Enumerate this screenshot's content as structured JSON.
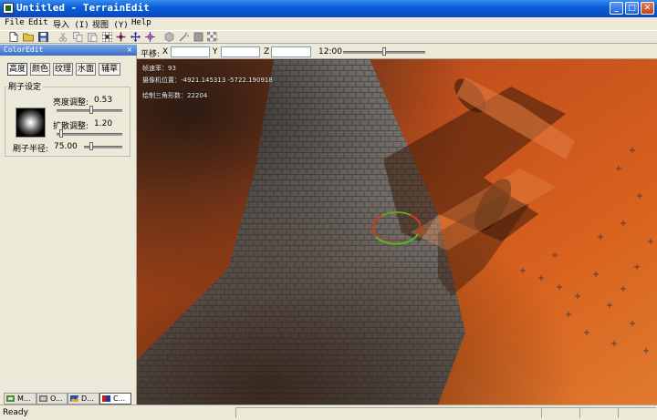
{
  "window": {
    "title": "Untitled - TerrainEdit",
    "minimize": "_",
    "maximize": "□",
    "close": "✕"
  },
  "menu": [
    "File",
    "Edit",
    "导入 (I)",
    "视图 (Y)",
    "Help"
  ],
  "toolbar": {
    "icons": [
      "new-file-icon",
      "open-folder-icon",
      "save-icon",
      "cut-icon",
      "copy-icon",
      "paste-icon",
      "grid-icon",
      "add-node-icon",
      "move-icon",
      "crosshair-icon",
      "cube-icon",
      "wand-icon",
      "block-icon",
      "checker-icon"
    ]
  },
  "panel": {
    "title": "ColorEdit",
    "close": "×",
    "tabs": [
      "高度",
      "颜色",
      "纹理",
      "水面",
      "辅草"
    ],
    "group_label": "刷子设定",
    "brightness_label": "亮度调整:",
    "brightness_value": "0.53",
    "brightness_level": 0.53,
    "spread_label": "扩散调整:",
    "spread_value": "1.20",
    "spread_level": 0.05,
    "radius_label": "刷子半径:",
    "radius_value": "75.00",
    "radius_level": 0.15
  },
  "bottom_tabs": [
    {
      "label": "M...",
      "icon": "layer-icon"
    },
    {
      "label": "O...",
      "icon": "object-icon"
    },
    {
      "label": "D...",
      "icon": "texture-icon"
    },
    {
      "label": "C...",
      "icon": "color-icon"
    }
  ],
  "controls": {
    "move_label": "平移:",
    "x_label": "X",
    "y_label": "Y",
    "z_label": "Z",
    "x_value": "",
    "y_value": "",
    "z_value": "",
    "time": "12:00",
    "time_level": 0.5
  },
  "viewport": {
    "fps": "帧速率：93",
    "camera": "摄像机位置：-4921.145313 -5722.190918",
    "triangles": "绘制三角形数：22204"
  },
  "status": {
    "text": "Ready"
  },
  "colors": {
    "titlebar": "#0a5fd8",
    "terrain": "#b4471a",
    "brush_ring_red": "#d23a1a",
    "brush_ring_green": "#3fc02a"
  }
}
